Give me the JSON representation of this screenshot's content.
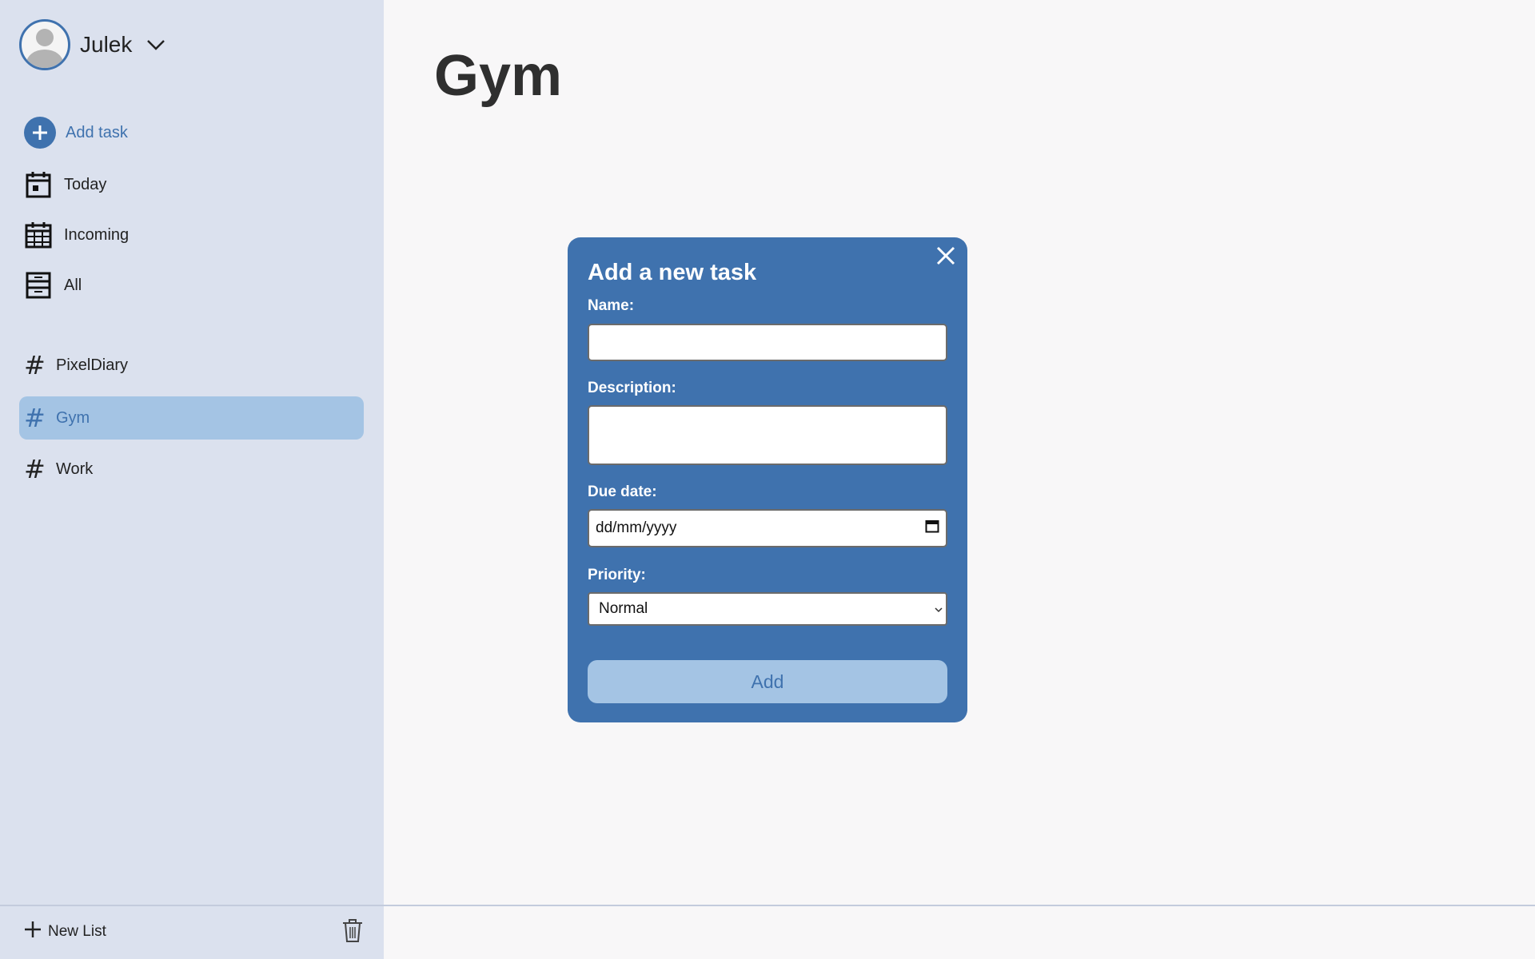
{
  "user": {
    "name": "Julek"
  },
  "nav": {
    "add_task": "Add task",
    "today": "Today",
    "incoming": "Incoming",
    "all": "All"
  },
  "lists": [
    {
      "name": "PixelDiary",
      "active": false
    },
    {
      "name": "Gym",
      "active": true
    },
    {
      "name": "Work",
      "active": false
    }
  ],
  "footer": {
    "new_list": "New List"
  },
  "main": {
    "title": "Gym"
  },
  "modal": {
    "title": "Add a new task",
    "name_label": "Name:",
    "name_value": "",
    "description_label": "Description:",
    "description_value": "",
    "due_label": "Due date:",
    "due_placeholder": "dd/mm/yyyy",
    "priority_label": "Priority:",
    "priority_value": "Normal",
    "submit_label": "Add"
  },
  "colors": {
    "accent": "#3f72ae",
    "accent_light": "#a4c4e4",
    "sidebar_bg": "#dbe1ee",
    "page_bg": "#f8f7f8"
  },
  "icons": {
    "user_avatar": "avatar",
    "user_menu": "chevron-down-icon",
    "add_task": "plus-circle-icon",
    "today": "calendar-day-icon",
    "incoming": "calendar-grid-icon",
    "all": "archive-icon",
    "list": "hash-icon",
    "new_list": "plus-icon",
    "delete": "trash-icon",
    "close": "close-icon",
    "date": "calendar-icon",
    "select": "chevron-down-icon"
  }
}
